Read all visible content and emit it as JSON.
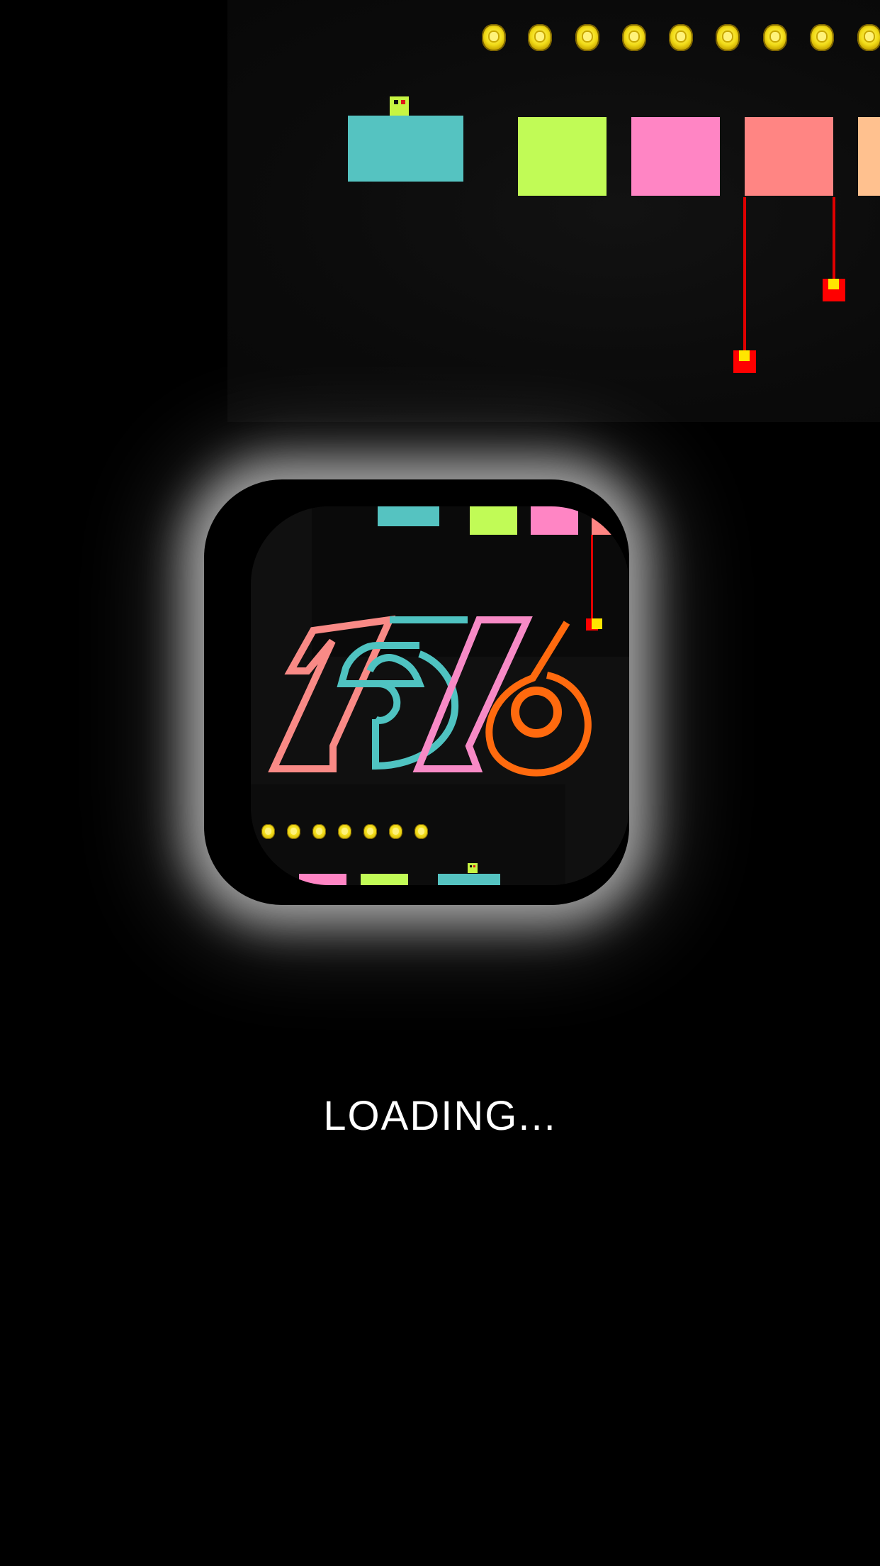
{
  "screen": "loading",
  "loading": {
    "label": "LOADING..."
  },
  "app_icon": {
    "logo_text": "1516",
    "colors": {
      "salmon": "#f98a86",
      "teal": "#4fc3c1",
      "pink": "#f78ac6",
      "orange": "#ff6a0e"
    }
  },
  "game_preview": {
    "coin_count_visible": 9,
    "block_colors": [
      "#55c3c1",
      "#c1fb56",
      "#ff85c4",
      "#ff8583",
      "#ffc18f"
    ],
    "hazard_color": "#ff0000",
    "player_color": "#c7f542"
  },
  "icons": {
    "coin": "coin-icon",
    "player": "player-icon",
    "hazard": "hanging-weight-icon"
  }
}
